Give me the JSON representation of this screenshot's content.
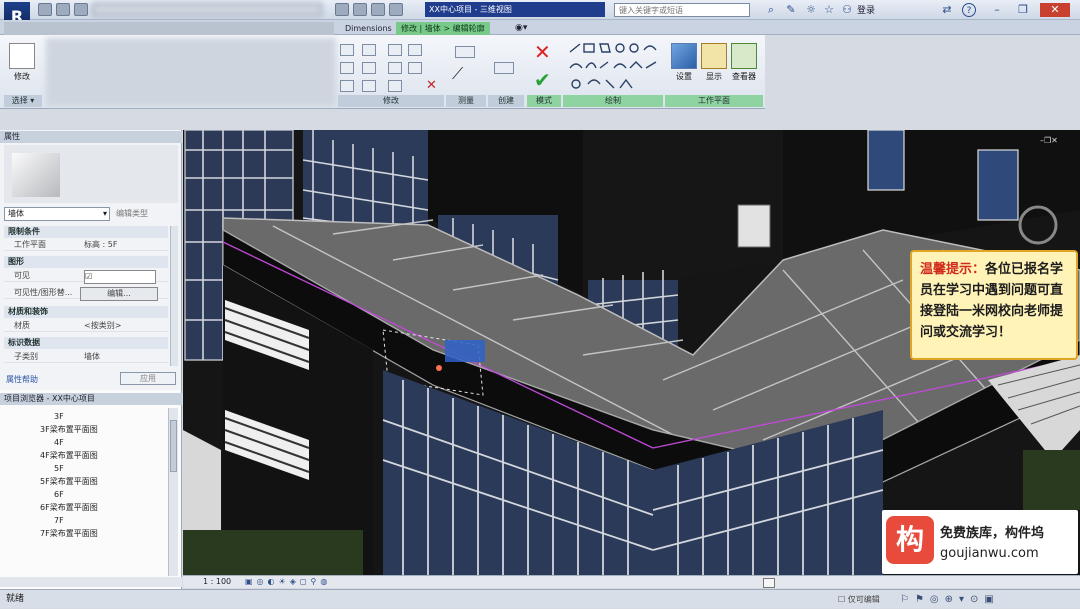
{
  "app": {
    "logo_letter": "R",
    "title": "XX中心项目 - 三维视图",
    "search_placeholder": "键入关键字或短语",
    "user": "登录",
    "help": "?"
  },
  "tabs": [
    {
      "label": "Dimensions",
      "style": "normal"
    },
    {
      "label": "修改 | 墙体 > 编辑轮廓",
      "style": "ctx"
    }
  ],
  "ribbon": {
    "modify_label": "修改",
    "select_label": "选择",
    "panels": [
      {
        "label": "修改",
        "style": "normal"
      },
      {
        "label": "测量",
        "style": "normal"
      },
      {
        "label": "创建",
        "style": "normal"
      },
      {
        "label": "模式",
        "style": "ctx"
      },
      {
        "label": "绘制",
        "style": "ctx"
      },
      {
        "label": "工作平面",
        "style": "ctx"
      }
    ],
    "workplane_buttons": [
      "设置",
      "显示",
      "查看器"
    ]
  },
  "properties": {
    "header": "属性",
    "type_selector": "墙体",
    "edit_type": "编辑类型",
    "groups": [
      {
        "name": "限制条件",
        "rows": [
          {
            "k": "工作平面",
            "v": "标高 : 5F"
          }
        ]
      },
      {
        "name": "图形",
        "rows": [
          {
            "k": "可见",
            "v": "☑"
          },
          {
            "k": "可见性/图形替...",
            "v": "编辑..."
          }
        ]
      },
      {
        "name": "材质和装饰",
        "rows": [
          {
            "k": "材质",
            "v": "<按类别>"
          }
        ]
      },
      {
        "name": "标识数据",
        "rows": [
          {
            "k": "子类别",
            "v": "墙体"
          }
        ]
      }
    ],
    "help_link": "属性帮助",
    "apply_button": "应用"
  },
  "browser": {
    "header": "项目浏览器 - XX中心项目",
    "items": [
      "3F",
      "3F梁布置平面图",
      "4F",
      "4F梁布置平面图",
      "5F",
      "5F梁布置平面图",
      "6F",
      "6F梁布置平面图",
      "7F",
      "7F梁布置平面图"
    ]
  },
  "viewctl": {
    "scale": "1 : 100"
  },
  "status": {
    "left": "就绪",
    "right": "仅可编辑"
  },
  "tip": {
    "prefix": "温馨提示：",
    "body": "各位已报名学员在学习中遇到问题可直接登陆一米网校向老师提问或交流学习！"
  },
  "watermark": {
    "brand": "免费族库，构件坞",
    "url": "goujianwu.com",
    "logo_char": "构"
  }
}
